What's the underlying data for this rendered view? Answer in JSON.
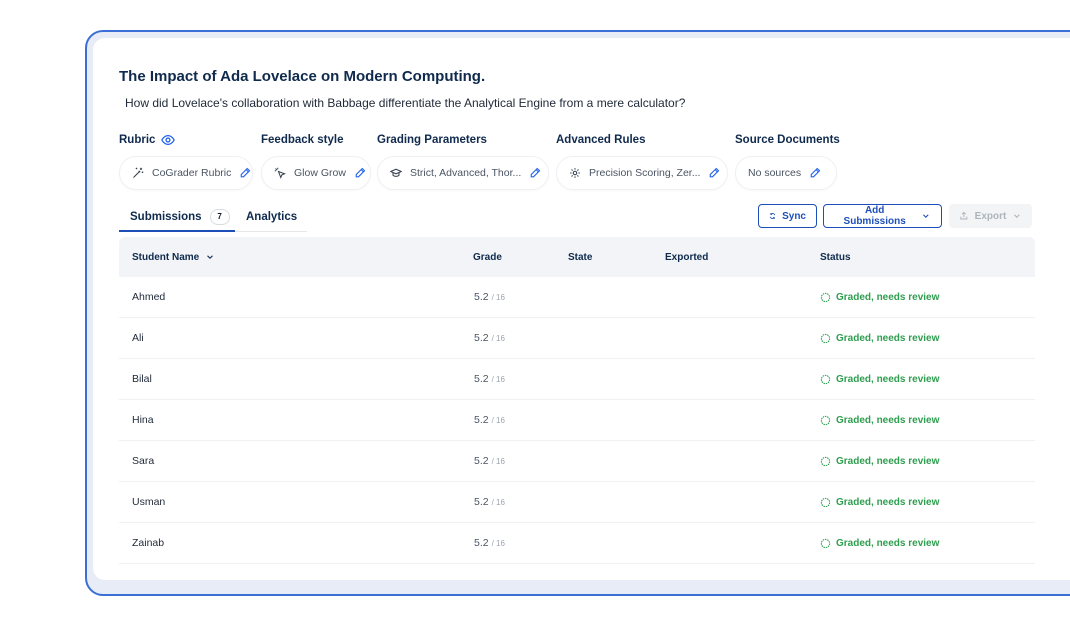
{
  "assignment": {
    "title": "The Impact of Ada Lovelace on Modern Computing.",
    "question": "How did Lovelace's collaboration with Babbage differentiate the Analytical Engine from a mere calculator?"
  },
  "settings": [
    {
      "label": "Rubric",
      "value": "CoGrader Rubric",
      "icon": "magic-wand-icon",
      "has_eye": true
    },
    {
      "label": "Feedback style",
      "value": "Glow Grow",
      "icon": "sparkle-cursor-icon"
    },
    {
      "label": "Grading Parameters",
      "value": "Strict, Advanced, Thor...",
      "icon": "graduation-cap-icon"
    },
    {
      "label": "Advanced Rules",
      "value": "Precision Scoring, Zer...",
      "icon": "gear-icon"
    },
    {
      "label": "Source Documents",
      "value": "No sources",
      "icon": ""
    }
  ],
  "tabs": {
    "submissions_label": "Submissions",
    "submissions_count": "7",
    "analytics_label": "Analytics"
  },
  "actions": {
    "sync_label": "Sync",
    "add_label": "Add Submissions",
    "export_label": "Export"
  },
  "table": {
    "headers": {
      "student": "Student Name",
      "grade": "Grade",
      "state": "State",
      "exported": "Exported",
      "status": "Status"
    },
    "rows": [
      {
        "name": "Ahmed",
        "grade": "5.2",
        "max": "/ 16",
        "status": "Graded, needs review"
      },
      {
        "name": "Ali",
        "grade": "5.2",
        "max": "/ 16",
        "status": "Graded, needs review"
      },
      {
        "name": "Bilal",
        "grade": "5.2",
        "max": "/ 16",
        "status": "Graded, needs review"
      },
      {
        "name": "Hina",
        "grade": "5.2",
        "max": "/ 16",
        "status": "Graded, needs review"
      },
      {
        "name": "Sara",
        "grade": "5.2",
        "max": "/ 16",
        "status": "Graded, needs review"
      },
      {
        "name": "Usman",
        "grade": "5.2",
        "max": "/ 16",
        "status": "Graded, needs review"
      },
      {
        "name": "Zainab",
        "grade": "5.2",
        "max": "/ 16",
        "status": "Graded, needs review"
      }
    ]
  },
  "colors": {
    "accent": "#1e4fb8",
    "frame": "#3b6fd6",
    "status_green": "#2e9e4f",
    "heading": "#0f2a4d"
  }
}
